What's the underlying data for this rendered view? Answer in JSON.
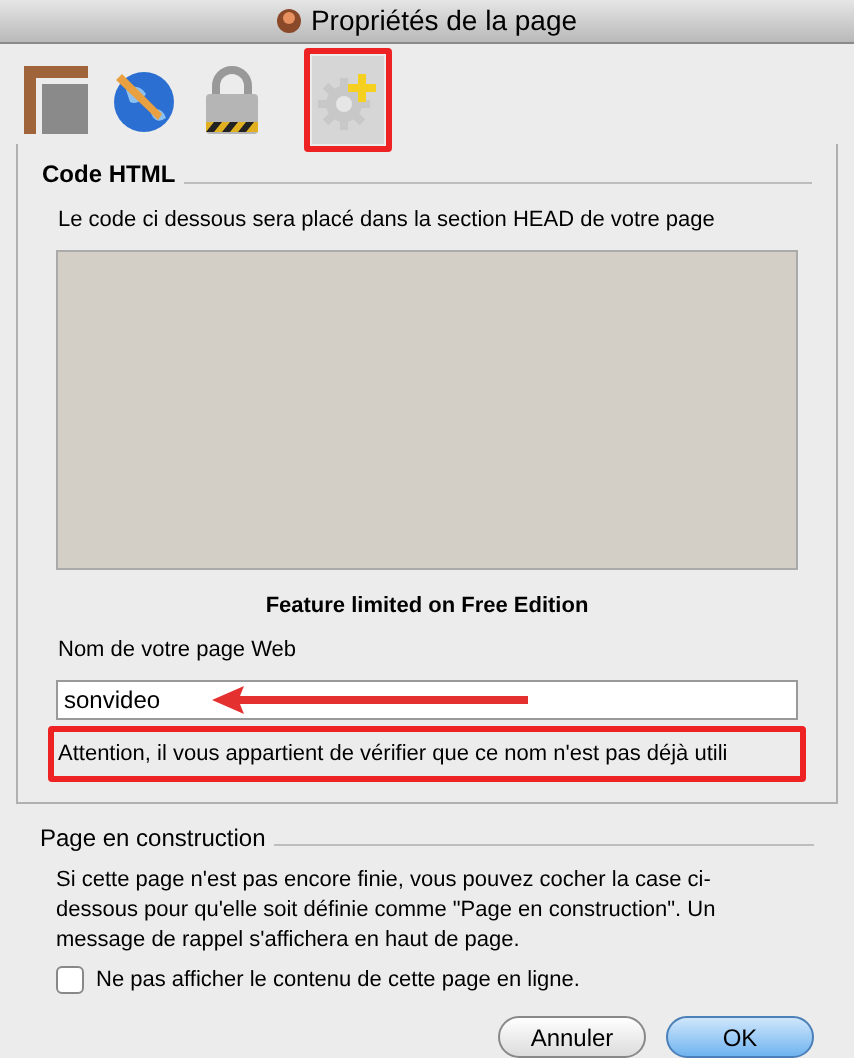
{
  "window": {
    "title": "Propriétés de la page"
  },
  "toolbar": [
    {
      "kind": "layout",
      "selected": false
    },
    {
      "kind": "globe",
      "selected": false
    },
    {
      "kind": "lock",
      "selected": false
    },
    {
      "kind": "gear",
      "selected": true
    }
  ],
  "code_section": {
    "title": "Code HTML",
    "description": "Le code ci dessous sera placé dans la section HEAD de votre page",
    "notice": "Feature limited on Free Edition"
  },
  "page_name": {
    "label": "Nom de votre page Web",
    "value": "sonvideo",
    "warning": "Attention, il vous appartient de vérifier que ce nom n'est pas déjà utili"
  },
  "construction_section": {
    "title": "Page en construction",
    "description": "Si cette page n'est pas encore finie, vous pouvez cocher la case ci-dessous pour qu'elle soit définie comme \"Page en construction\". Un message de rappel s'affichera en haut de page.",
    "checkbox": {
      "label": "Ne pas afficher le contenu de cette page en ligne.",
      "checked": false
    }
  },
  "buttons": [
    {
      "label": "Annuler",
      "kind": "cancel"
    },
    {
      "label": "OK",
      "kind": "default"
    }
  ]
}
